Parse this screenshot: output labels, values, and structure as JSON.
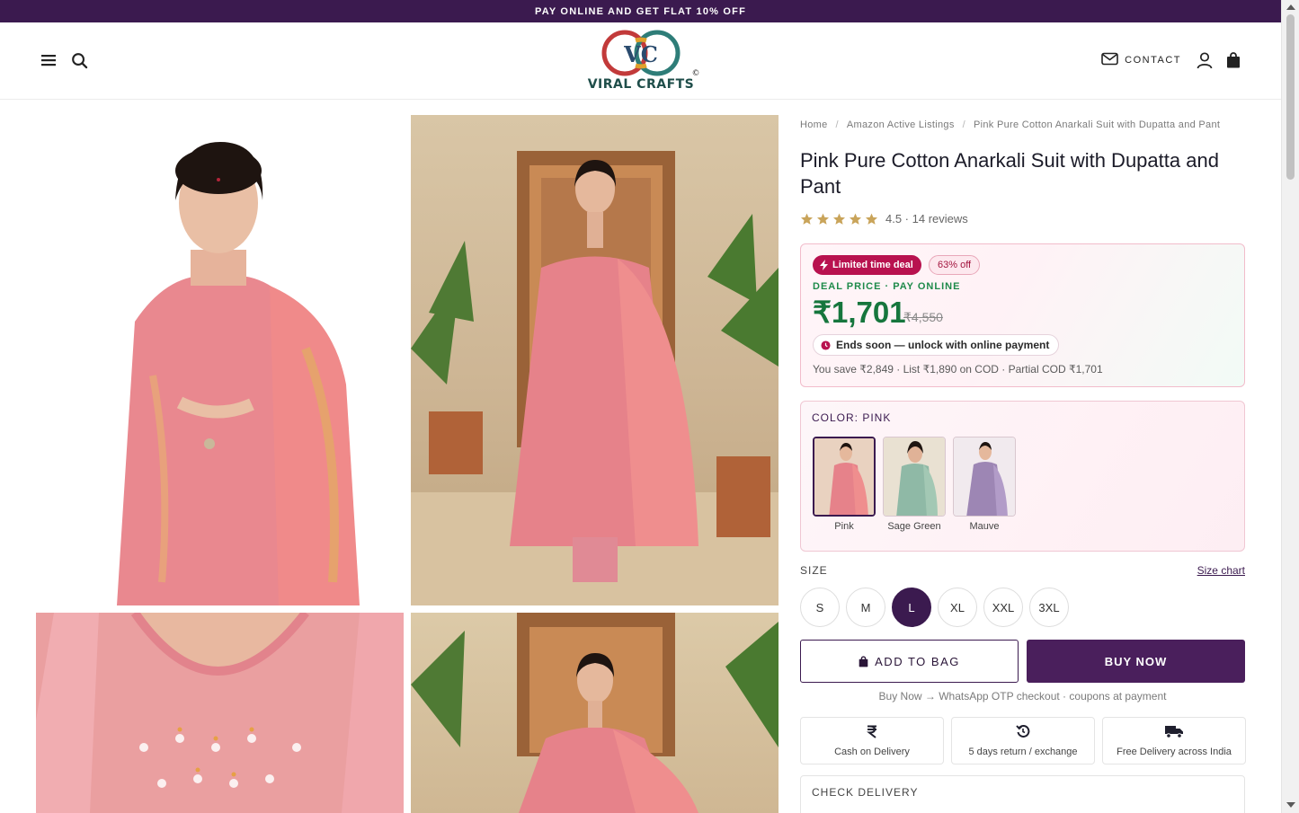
{
  "announcement": "PAY ONLINE AND GET FLAT 10% OFF",
  "header": {
    "logo_text": "VIRAL CRAFTS",
    "logo_monogram": "VC",
    "contact_label": "CONTACT",
    "icons": [
      "menu-icon",
      "search-icon",
      "mail-icon",
      "user-icon",
      "bag-icon"
    ]
  },
  "breadcrumb": [
    "Home",
    "Amazon Active Listings",
    "Pink Pure Cotton Anarkali Suit with Dupatta and Pant"
  ],
  "product": {
    "title": "Pink Pure Cotton Anarkali Suit with Dupatta and Pant",
    "rating_text": "4.5 · 14 reviews",
    "rating": 4.5,
    "star_count": 5
  },
  "deal": {
    "badge": "Limited time deal",
    "discount": "63% off",
    "label": "DEAL PRICE · PAY ONLINE",
    "price": "₹1,701",
    "mrp": "₹4,550",
    "ends": "Ends soon — unlock with online payment",
    "savings": "You save ₹2,849 · List ₹1,890 on COD · Partial COD ₹1,701"
  },
  "color": {
    "label": "COLOR: PINK",
    "options": [
      {
        "name": "Pink",
        "selected": true
      },
      {
        "name": "Sage Green",
        "selected": false
      },
      {
        "name": "Mauve",
        "selected": false
      }
    ]
  },
  "size": {
    "label": "SIZE",
    "chart_link": "Size chart",
    "options": [
      "S",
      "M",
      "L",
      "XL",
      "XXL",
      "3XL"
    ],
    "selected": "L"
  },
  "actions": {
    "add_to_bag": "ADD TO BAG",
    "buy_now": "BUY NOW",
    "note": "Buy Now → WhatsApp OTP checkout · coupons at payment"
  },
  "features": [
    {
      "icon": "rupee-icon",
      "label": "Cash on Delivery"
    },
    {
      "icon": "return-icon",
      "label": "5 days return / exchange"
    },
    {
      "icon": "truck-icon",
      "label": "Free Delivery across India"
    }
  ],
  "check_delivery": "CHECK DELIVERY",
  "colors": {
    "brand": "#3b1a4f",
    "deal_green": "#16763d",
    "deal_badge": "#b8124f"
  }
}
